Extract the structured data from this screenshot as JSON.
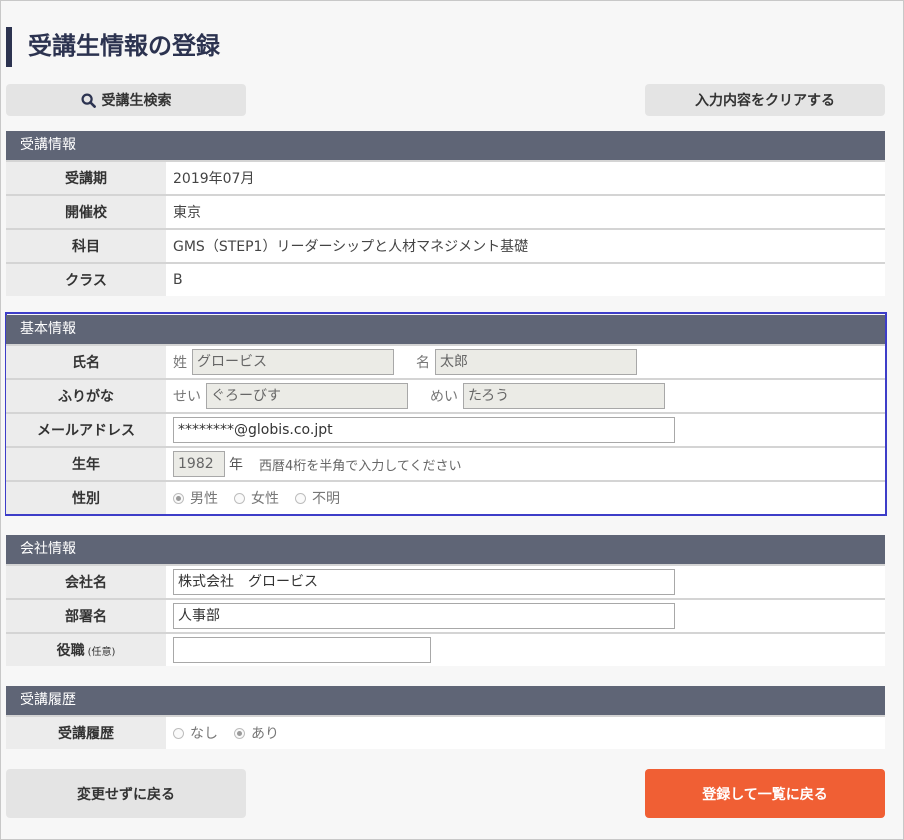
{
  "page": {
    "title": "受講生情報の登録"
  },
  "toolbar": {
    "search_label": "受講生検索",
    "clear_label": "入力内容をクリアする"
  },
  "course": {
    "heading": "受講情報",
    "rows": [
      {
        "label": "受講期",
        "value": "2019年07月"
      },
      {
        "label": "開催校",
        "value": "東京"
      },
      {
        "label": "科目",
        "value": "GMS（STEP1）リーダーシップと人材マネジメント基礎"
      },
      {
        "label": "クラス",
        "value": "B"
      }
    ]
  },
  "basic": {
    "heading": "基本情報",
    "name": {
      "label": "氏名",
      "last_prefix": "姓",
      "last_value": "グロービス",
      "first_prefix": "名",
      "first_value": "太郎"
    },
    "kana": {
      "label": "ふりがな",
      "last_prefix": "せい",
      "last_value": "ぐろーびす",
      "first_prefix": "めい",
      "first_value": "たろう"
    },
    "email": {
      "label": "メールアドレス",
      "value": "********@globis.co.jpt"
    },
    "birth": {
      "label": "生年",
      "value": "1982",
      "unit": "年",
      "note": "西暦4桁を半角で入力してください"
    },
    "gender": {
      "label": "性別",
      "options": [
        "男性",
        "女性",
        "不明"
      ],
      "selected": "男性"
    }
  },
  "company": {
    "heading": "会社情報",
    "name": {
      "label": "会社名",
      "value": "株式会社　グロービス"
    },
    "dept": {
      "label": "部署名",
      "value": "人事部"
    },
    "role": {
      "label": "役職",
      "label_note": "(任意)",
      "value": ""
    }
  },
  "history": {
    "heading": "受講履歴",
    "row": {
      "label": "受講履歴",
      "options": [
        "なし",
        "あり"
      ],
      "selected": "あり"
    }
  },
  "footer": {
    "back_label": "変更せずに戻る",
    "register_label": "登録して一覧に戻る"
  },
  "colors": {
    "accent": "#f05f34",
    "section_header": "#5f6576",
    "title_bar": "#2c3350",
    "focus_border": "#3d3dc8"
  }
}
